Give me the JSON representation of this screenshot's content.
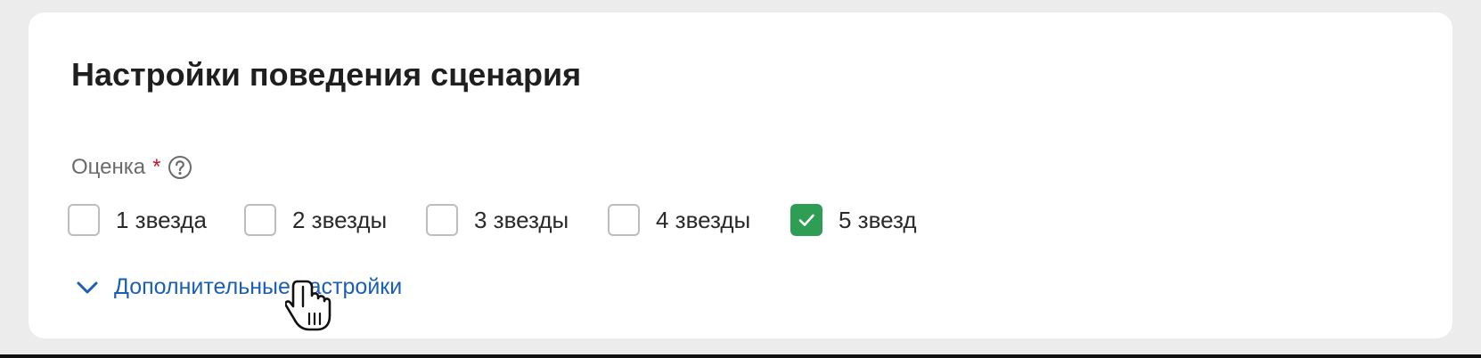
{
  "section": {
    "title": "Настройки поведения сценария"
  },
  "rating_field": {
    "label": "Оценка",
    "required_mark": "*",
    "help_icon": "question-circle-icon",
    "options": [
      {
        "label": "1 звезда",
        "checked": false
      },
      {
        "label": "2 звезды",
        "checked": false
      },
      {
        "label": "3 звезды",
        "checked": false
      },
      {
        "label": "4 звезды",
        "checked": false
      },
      {
        "label": "5 звезд",
        "checked": true
      }
    ]
  },
  "more_settings": {
    "label": "Дополнительные настройки",
    "icon": "chevron-down-icon"
  },
  "colors": {
    "checked_fill": "#2f9e55",
    "link": "#1a5fb4",
    "required": "#c8102e"
  }
}
